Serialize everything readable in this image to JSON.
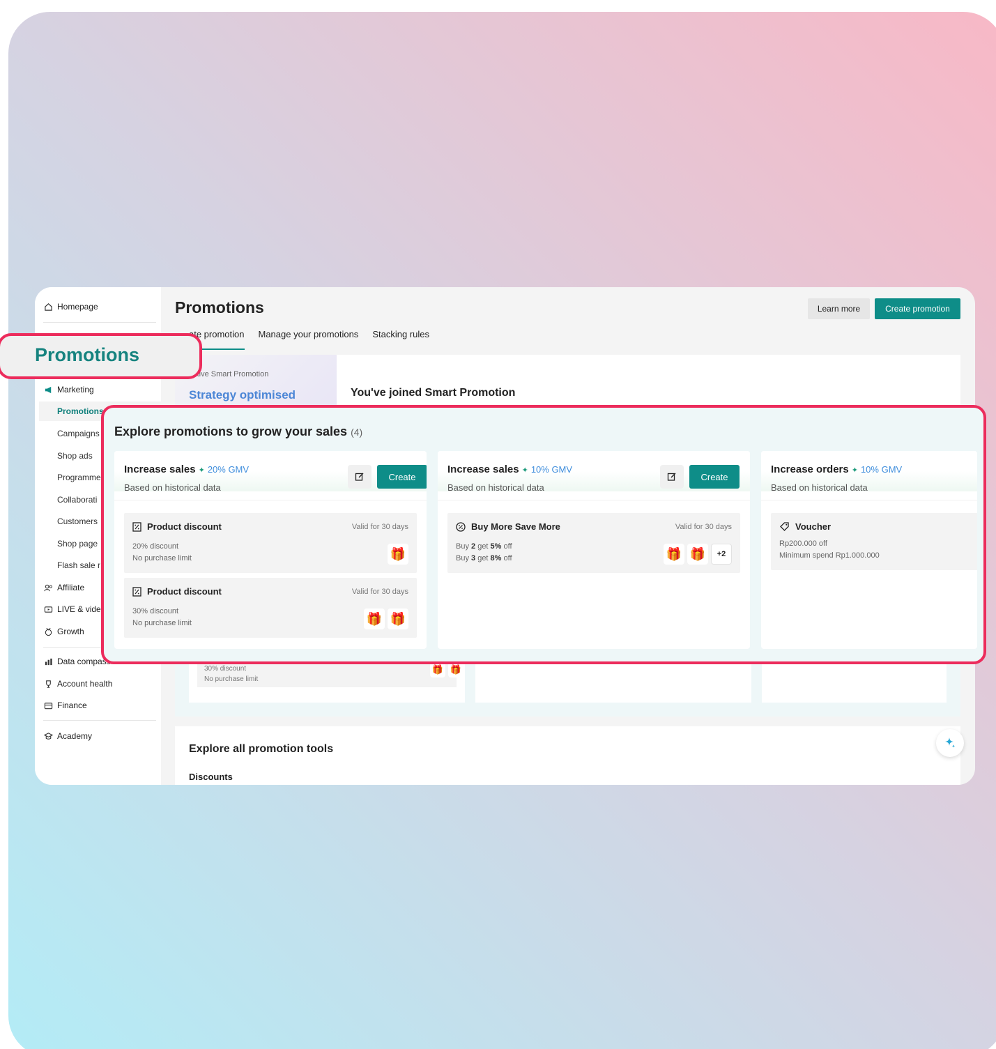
{
  "sidebar": {
    "homepage": "Homepage",
    "marketing": "Marketing",
    "marketing_items": [
      "Promotions",
      "Campaigns",
      "Shop ads",
      "Programme",
      "Collaborati",
      "Customers",
      "Shop page",
      "Flash sale r"
    ],
    "affiliate": "Affiliate",
    "live": "LIVE & vide",
    "growth": "Growth",
    "data_compass": "Data compass",
    "account_health": "Account health",
    "finance": "Finance",
    "academy": "Academy"
  },
  "header": {
    "title": "Promotions",
    "learn_more": "Learn more",
    "create_promotion": "Create promotion"
  },
  "tabs": [
    "ate promotion",
    "Manage your promotions",
    "Stacking rules"
  ],
  "smart": {
    "caption": "active Smart Promotion",
    "status": "Strategy optimised",
    "joined": "You've joined Smart Promotion"
  },
  "callout": {
    "label": "Promotions"
  },
  "explore": {
    "heading": "Explore promotions to grow your sales",
    "count": "(4)",
    "cards": [
      {
        "title": "Increase sales",
        "gmv": "20% GMV",
        "subtitle": "Based on historical data",
        "create": "Create",
        "items": [
          {
            "name": "Product discount",
            "valid": "Valid for 30 days",
            "line1": "20% discount",
            "line2": "No purchase limit"
          },
          {
            "name": "Product discount",
            "valid": "Valid for 30 days",
            "line1": "30% discount",
            "line2": "No purchase limit"
          }
        ]
      },
      {
        "title": "Increase sales",
        "gmv": "10% GMV",
        "subtitle": "Based on historical data",
        "create": "Create",
        "items": [
          {
            "name": "Buy More Save More",
            "valid": "Valid for 30 days",
            "line1_pre": "Buy ",
            "line1_qty": "2",
            "line1_mid": " get ",
            "line1_pct": "5%",
            "line1_post": " off",
            "line2_pre": "Buy ",
            "line2_qty": "3",
            "line2_mid": " get ",
            "line2_pct": "8%",
            "line2_post": " off",
            "more": "+2"
          }
        ]
      },
      {
        "title": "Increase orders",
        "gmv": "10% GMV",
        "subtitle": "Based on historical data",
        "items": [
          {
            "name": "Voucher",
            "line1": "Rp200.000 off",
            "line2": "Minimum spend Rp1.000.000"
          }
        ]
      }
    ]
  },
  "under": {
    "line1": "30% discount",
    "line2": "No purchase limit"
  },
  "tools": {
    "heading": "Explore all promotion tools",
    "sub": "Discounts"
  },
  "colors": {
    "accent": "#0e8d88",
    "highlight": "#ec2c5c",
    "gmv": "#3f8edc"
  },
  "icons": [
    "home-icon",
    "megaphone-icon",
    "affiliate-icon",
    "live-icon",
    "growth-icon",
    "chart-icon",
    "trophy-icon",
    "wallet-icon",
    "academy-icon",
    "edit-icon",
    "discount-tag-icon",
    "percent-icon",
    "voucher-icon",
    "gift-icon",
    "sparkle-icon"
  ]
}
